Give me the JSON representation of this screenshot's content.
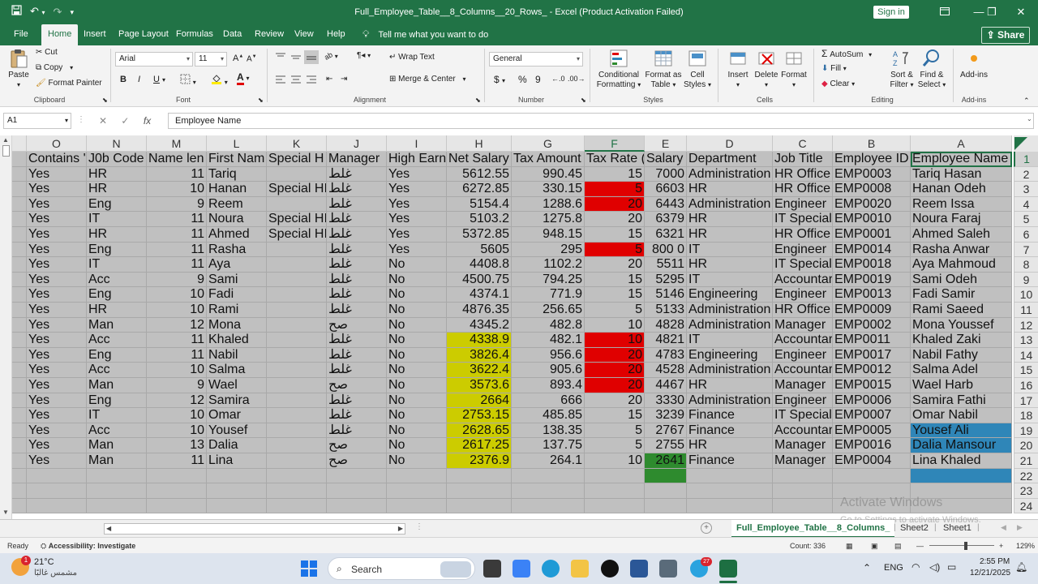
{
  "window": {
    "title": "Full_Employee_Table__8_Columns__20_Rows_  -  Excel (Product Activation Failed)",
    "sign_in": "Sign in",
    "share": "Share"
  },
  "tabs": [
    "File",
    "Home",
    "Insert",
    "Page Layout",
    "Formulas",
    "Data",
    "Review",
    "View",
    "Help"
  ],
  "active_tab": "Home",
  "tell_me": "Tell me what you want to do",
  "ribbon": {
    "clipboard": {
      "label": "Clipboard",
      "paste": "Paste",
      "cut": "Cut",
      "copy": "Copy",
      "format_painter": "Format Painter"
    },
    "font": {
      "label": "Font",
      "name": "Arial",
      "size": "11",
      "bold": "B",
      "italic": "I",
      "underline": "U"
    },
    "alignment": {
      "label": "Alignment",
      "wrap": "Wrap Text",
      "merge": "Merge & Center"
    },
    "number": {
      "label": "Number",
      "format": "General",
      "currency": "$",
      "percent": "%",
      "comma": "9"
    },
    "styles": {
      "label": "Styles",
      "cond1": "Conditional",
      "cond2": "Formatting",
      "fmt1": "Format as",
      "fmt2": "Table",
      "cell1": "Cell",
      "cell2": "Styles"
    },
    "cells": {
      "label": "Cells",
      "insert": "Insert",
      "delete": "Delete",
      "format": "Format"
    },
    "editing": {
      "label": "Editing",
      "autosum": "AutoSum",
      "fill": "Fill",
      "clear": "Clear",
      "sort1": "Sort &",
      "sort2": "Filter",
      "find1": "Find &",
      "find2": "Select"
    },
    "addins": {
      "label": "Add-ins",
      "addins": "Add-ins"
    }
  },
  "formula_bar": {
    "name_box": "A1",
    "fx": "fx",
    "content": "Employee Name"
  },
  "columns": [
    "O",
    "N",
    "M",
    "L",
    "K",
    "J",
    "I",
    "H",
    "G",
    "F",
    "E",
    "D",
    "C",
    "B",
    "A"
  ],
  "selected_column": "F",
  "header_row": [
    "Contains '",
    "J0b Code",
    "Name len",
    "First Nam",
    "Special H",
    "Manager",
    "High Earn",
    "Net Salary",
    "Tax Amount",
    "Tax Rate (",
    "Salary",
    "Department",
    "Job Title",
    "Employee ID",
    "Employee Name"
  ],
  "rows": [
    [
      "Yes",
      "HR",
      "11",
      "Tariq",
      "",
      "غلط",
      "Yes",
      "5612.55",
      "990.45",
      "15",
      "7000",
      "Administration",
      "HR Office",
      "EMP0003",
      "Tariq Hasan"
    ],
    [
      "Yes",
      "HR",
      "10",
      "Hanan",
      "Special HI",
      "غلط",
      "Yes",
      "6272.85",
      "330.15",
      "5",
      "6603",
      "HR",
      "HR Office",
      "EMP0008",
      "Hanan Odeh"
    ],
    [
      "Yes",
      "Eng",
      "9",
      "Reem",
      "",
      "غلط",
      "Yes",
      "5154.4",
      "1288.6",
      "20",
      "6443",
      "Administration",
      "Engineer",
      "EMP0020",
      "Reem Issa"
    ],
    [
      "Yes",
      "IT",
      "11",
      "Noura",
      "Special HI",
      "غلط",
      "Yes",
      "5103.2",
      "1275.8",
      "20",
      "6379",
      "HR",
      "IT Special",
      "EMP0010",
      "Noura Faraj"
    ],
    [
      "Yes",
      "HR",
      "11",
      "Ahmed",
      "Special HI",
      "غلط",
      "Yes",
      "5372.85",
      "948.15",
      "15",
      "6321",
      "HR",
      "HR Office",
      "EMP0001",
      "Ahmed Saleh"
    ],
    [
      "Yes",
      "Eng",
      "11",
      "Rasha",
      "",
      "غلط",
      "Yes",
      "5605",
      "295",
      "5",
      "800  0",
      "IT",
      "Engineer",
      "EMP0014",
      "Rasha Anwar"
    ],
    [
      "Yes",
      "IT",
      "11",
      "Aya",
      "",
      "غلط",
      "No",
      "4408.8",
      "1102.2",
      "20",
      "5511",
      "HR",
      "IT Special",
      "EMP0018",
      "Aya Mahmoud"
    ],
    [
      "Yes",
      "Acc",
      "9",
      "Sami",
      "",
      "غلط",
      "No",
      "4500.75",
      "794.25",
      "15",
      "5295",
      "IT",
      "Accountar",
      "EMP0019",
      "Sami Odeh"
    ],
    [
      "Yes",
      "Eng",
      "10",
      "Fadi",
      "",
      "غلط",
      "No",
      "4374.1",
      "771.9",
      "15",
      "5146",
      "Engineering",
      "Engineer",
      "EMP0013",
      "Fadi Samir"
    ],
    [
      "Yes",
      "HR",
      "10",
      "Rami",
      "",
      "غلط",
      "No",
      "4876.35",
      "256.65",
      "5",
      "5133",
      "Administration",
      "HR Office",
      "EMP0009",
      "Rami Saeed"
    ],
    [
      "Yes",
      "Man",
      "12",
      "Mona",
      "",
      "صح",
      "No",
      "4345.2",
      "482.8",
      "10",
      "4828",
      "Administration",
      "Manager",
      "EMP0002",
      "Mona Youssef"
    ],
    [
      "Yes",
      "Acc",
      "11",
      "Khaled",
      "",
      "غلط",
      "No",
      "4338.9",
      "482.1",
      "10",
      "4821",
      "IT",
      "Accountar",
      "EMP0011",
      "Khaled Zaki"
    ],
    [
      "Yes",
      "Eng",
      "11",
      "Nabil",
      "",
      "غلط",
      "No",
      "3826.4",
      "956.6",
      "20",
      "4783",
      "Engineering",
      "Engineer",
      "EMP0017",
      "Nabil Fathy"
    ],
    [
      "Yes",
      "Acc",
      "10",
      "Salma",
      "",
      "غلط",
      "No",
      "3622.4",
      "905.6",
      "20",
      "4528",
      "Administration",
      "Accountar",
      "EMP0012",
      "Salma Adel"
    ],
    [
      "Yes",
      "Man",
      "9",
      "Wael",
      "",
      "صح",
      "No",
      "3573.6",
      "893.4",
      "20",
      "4467",
      "HR",
      "Manager",
      "EMP0015",
      "Wael Harb"
    ],
    [
      "Yes",
      "Eng",
      "12",
      "Samira",
      "",
      "غلط",
      "No",
      "2664",
      "666",
      "20",
      "3330",
      "Administration",
      "Engineer",
      "EMP0006",
      "Samira Fathi"
    ],
    [
      "Yes",
      "IT",
      "10",
      "Omar",
      "",
      "غلط",
      "No",
      "2753.15",
      "485.85",
      "15",
      "3239",
      "Finance",
      "IT Special",
      "EMP0007",
      "Omar Nabil"
    ],
    [
      "Yes",
      "Acc",
      "10",
      "Yousef",
      "",
      "غلط",
      "No",
      "2628.65",
      "138.35",
      "5",
      "2767",
      "Finance",
      "Accountar",
      "EMP0005",
      "Yousef Ali"
    ],
    [
      "Yes",
      "Man",
      "13",
      "Dalia",
      "",
      "صح",
      "No",
      "2617.25",
      "137.75",
      "5",
      "2755",
      "HR",
      "Manager",
      "EMP0016",
      "Dalia Mansour"
    ],
    [
      "Yes",
      "Man",
      "11",
      "Lina",
      "",
      "صح",
      "No",
      "2376.9",
      "264.1",
      "10",
      "2641",
      "Finance",
      "Manager",
      "EMP0004",
      "Lina Khaled"
    ]
  ],
  "row_numbers": [
    "1",
    "2",
    "3",
    "4",
    "5",
    "6",
    "7",
    "8",
    "9",
    "10",
    "11",
    "12",
    "13",
    "14",
    "15",
    "16",
    "17",
    "18",
    "19",
    "20",
    "21",
    "22",
    "23",
    "24"
  ],
  "highlight_colors": {
    "red": "#e00000",
    "yellow": "#cccc00",
    "green": "#2e8b2e",
    "blue": "#2f86b8"
  },
  "highlights": {
    "red": [
      [
        2,
        9
      ],
      [
        3,
        9
      ],
      [
        6,
        9
      ],
      [
        12,
        9
      ],
      [
        13,
        9
      ],
      [
        14,
        9
      ],
      [
        15,
        9
      ]
    ],
    "yellow": [
      [
        12,
        7
      ],
      [
        13,
        7
      ],
      [
        14,
        7
      ],
      [
        15,
        7
      ],
      [
        16,
        7
      ],
      [
        17,
        7
      ],
      [
        18,
        7
      ],
      [
        19,
        7
      ],
      [
        20,
        7
      ]
    ],
    "green": [
      [
        20,
        10
      ],
      [
        21,
        10
      ]
    ],
    "blue": [
      [
        18,
        14
      ],
      [
        19,
        14
      ],
      [
        21,
        14
      ]
    ]
  },
  "activate_windows": {
    "line1": "Activate Windows",
    "line2": "Go to Settings to activate Windows."
  },
  "sheets": [
    "Full_Employee_Table__8_Columns_",
    "Sheet2",
    "Sheet1"
  ],
  "active_sheet": "Full_Employee_Table__8_Columns_",
  "status": {
    "ready": "Ready",
    "accessibility": "Accessibility: Investigate",
    "count": "Count: 336",
    "zoom": "129%"
  },
  "taskbar": {
    "weather_temp": "21°C",
    "weather_desc": "مشمس غالبًا",
    "weather_badge": "1",
    "search": "Search",
    "language": "ENG",
    "time": "2:55 PM",
    "date": "12/21/2025",
    "telegram_badge": "27"
  }
}
